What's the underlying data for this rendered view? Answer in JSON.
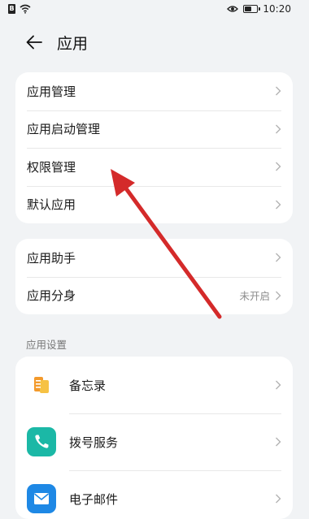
{
  "status_bar": {
    "time": "10:20",
    "sim_label": "B",
    "battery_level": 0.6
  },
  "header": {
    "title": "应用"
  },
  "card1": {
    "items": [
      {
        "label": "应用管理"
      },
      {
        "label": "应用启动管理"
      },
      {
        "label": "权限管理"
      },
      {
        "label": "默认应用"
      }
    ]
  },
  "card2": {
    "items": [
      {
        "label": "应用助手",
        "value": ""
      },
      {
        "label": "应用分身",
        "value": "未开启"
      }
    ]
  },
  "section": {
    "title": "应用设置"
  },
  "apps": [
    {
      "label": "备忘录",
      "icon": "memo-icon"
    },
    {
      "label": "拨号服务",
      "icon": "phone-icon"
    },
    {
      "label": "电子邮件",
      "icon": "email-icon"
    }
  ],
  "colors": {
    "accent_arrow": "#d42a2a",
    "card_bg": "#ffffff",
    "page_bg": "#f1f3f5"
  }
}
